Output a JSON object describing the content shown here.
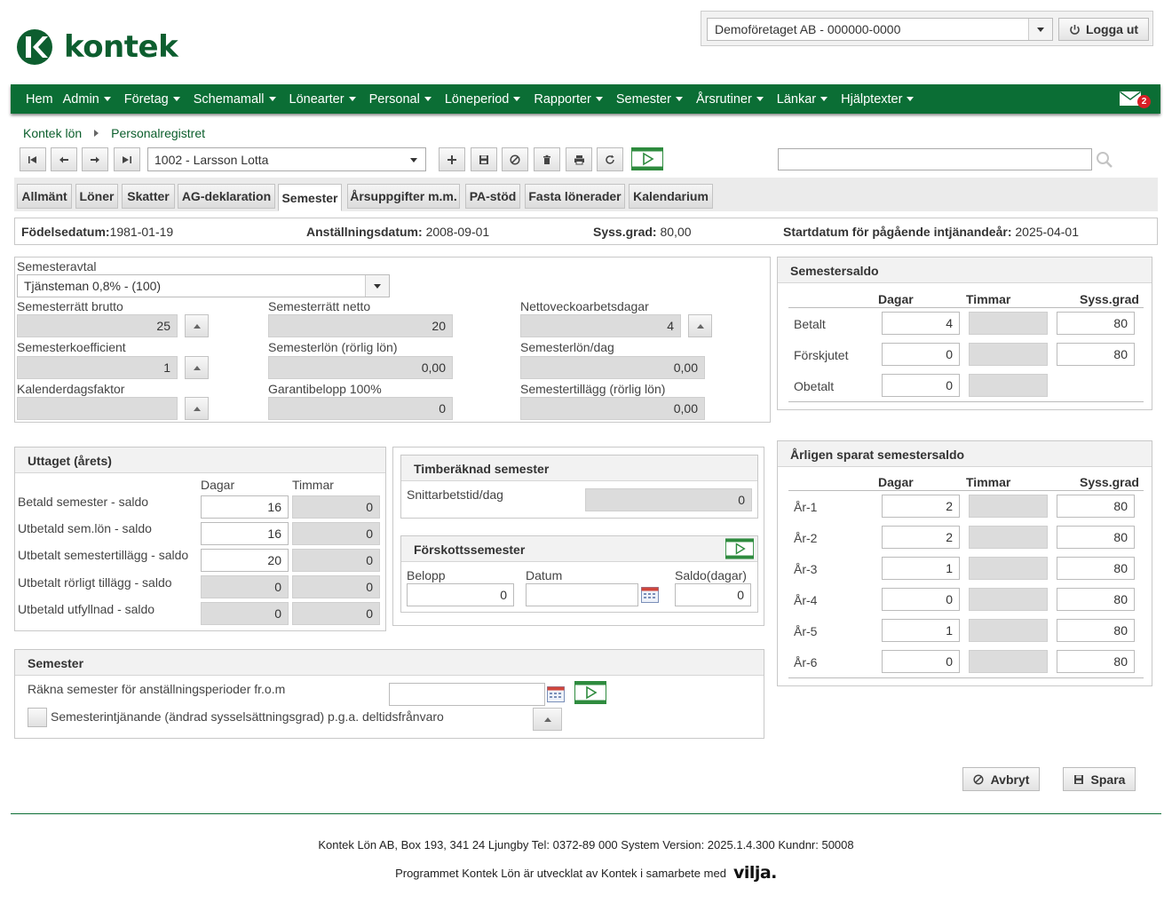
{
  "header": {
    "logo_text": "kontek",
    "company": "Demoföretaget AB - 000000-0000",
    "logout_label": "Logga ut"
  },
  "nav": {
    "items": [
      "Hem",
      "Admin",
      "Företag",
      "Schemamall",
      "Lönearter",
      "Personal",
      "Löneperiod",
      "Rapporter",
      "Semester",
      "Årsrutiner",
      "Länkar",
      "Hjälptexter"
    ],
    "mail_count": "2"
  },
  "breadcrumb": [
    "Kontek lön",
    "Personalregistret"
  ],
  "toolbar": {
    "employee": "1002 - Larsson Lotta",
    "search_value": ""
  },
  "tabs": [
    "Allmänt",
    "Löner",
    "Skatter",
    "AG-deklaration",
    "Semester",
    "Årsuppgifter m.m.",
    "PA-stöd",
    "Fasta lönerader",
    "Kalendarium"
  ],
  "active_tab": "Semester",
  "info": {
    "birth_label": "Födelsedatum:",
    "birth_value": "1981-01-19",
    "employment_label": "Anställningsdatum:",
    "employment_value": "2008-09-01",
    "syss_label": "Syss.grad:",
    "syss_value": "80,00",
    "start_label": "Startdatum för pågående intjänandeår:",
    "start_value": "2025-04-01"
  },
  "avtal": {
    "semesteravtal_label": "Semesteravtal",
    "semesteravtal_value": "Tjänsteman 0,8% - (100)",
    "brutto_label": "Semesterrätt brutto",
    "brutto_value": "25",
    "netto_label": "Semesterrätt netto",
    "netto_value": "20",
    "nettovecko_label": "Nettoveckoarbetsdagar",
    "nettovecko_value": "4",
    "koeff_label": "Semesterkoefficient",
    "koeff_value": "1",
    "semlon_label": "Semesterlön (rörlig lön)",
    "semlon_value": "0,00",
    "semlondag_label": "Semesterlön/dag",
    "semlondag_value": "0,00",
    "kalender_label": "Kalenderdagsfaktor",
    "kalender_value": "",
    "garanti_label": "Garantibelopp 100%",
    "garanti_value": "0",
    "tillagg_label": "Semestertillägg (rörlig lön)",
    "tillagg_value": "0,00"
  },
  "saldo": {
    "title": "Semestersaldo",
    "col_dagar": "Dagar",
    "col_timmar": "Timmar",
    "col_syss": "Syss.grad",
    "rows": [
      {
        "label": "Betalt",
        "dagar": "4",
        "timmar": "",
        "syss": "80"
      },
      {
        "label": "Förskjutet",
        "dagar": "0",
        "timmar": "",
        "syss": "80"
      },
      {
        "label": "Obetalt",
        "dagar": "0",
        "timmar": ""
      }
    ]
  },
  "uttaget": {
    "title": "Uttaget (årets)",
    "col_dagar": "Dagar",
    "col_timmar": "Timmar",
    "rows": [
      {
        "label": "Betald semester - saldo",
        "dagar": "16",
        "timmar": "0"
      },
      {
        "label": "Utbetald sem.lön - saldo",
        "dagar": "16",
        "timmar": "0"
      },
      {
        "label": "Utbetalt semestertillägg - saldo",
        "dagar": "20",
        "timmar": "0"
      },
      {
        "label": "Utbetalt rörligt tillägg - saldo",
        "dagar": "0",
        "timmar": "0"
      },
      {
        "label": "Utbetald utfyllnad - saldo",
        "dagar": "0",
        "timmar": "0"
      }
    ]
  },
  "timberaknad": {
    "title": "Timberäknad semester",
    "snitt_label": "Snittarbetstid/dag",
    "snitt_value": "0"
  },
  "forskott": {
    "title": "Förskottssemester",
    "belopp_label": "Belopp",
    "belopp_value": "0",
    "datum_label": "Datum",
    "datum_value": "",
    "saldo_label": "Saldo(dagar)",
    "saldo_value": "0"
  },
  "arligen": {
    "title": "Årligen sparat semestersaldo",
    "col_dagar": "Dagar",
    "col_timmar": "Timmar",
    "col_syss": "Syss.grad",
    "rows": [
      {
        "label": "År-1",
        "dagar": "2",
        "timmar": "",
        "syss": "80"
      },
      {
        "label": "År-2",
        "dagar": "2",
        "timmar": "",
        "syss": "80"
      },
      {
        "label": "År-3",
        "dagar": "1",
        "timmar": "",
        "syss": "80"
      },
      {
        "label": "År-4",
        "dagar": "0",
        "timmar": "",
        "syss": "80"
      },
      {
        "label": "År-5",
        "dagar": "1",
        "timmar": "",
        "syss": "80"
      },
      {
        "label": "År-6",
        "dagar": "0",
        "timmar": "",
        "syss": "80"
      }
    ]
  },
  "semester": {
    "title": "Semester",
    "rakna_label": "Räkna semester för anställningsperioder fr.o.m",
    "rakna_value": "",
    "intjanande_label": "Semesterintjänande (ändrad sysselsättningsgrad) p.g.a. deltidsfrånvaro"
  },
  "actions": {
    "cancel_label": "Avbryt",
    "save_label": "Spara"
  },
  "footer": {
    "line1": "Kontek Lön AB, Box 193, 341 24 Ljungby Tel: 0372-89 000 System Version: 2025.1.4.300 Kundnr: 50008",
    "line2": "Programmet Kontek Lön är utvecklat av Kontek i samarbete med",
    "partner": "vilja."
  },
  "colors": {
    "brand_green": "#0b6e35",
    "badge_red": "#d91f26",
    "readonly_gray": "#dcdcdc"
  }
}
